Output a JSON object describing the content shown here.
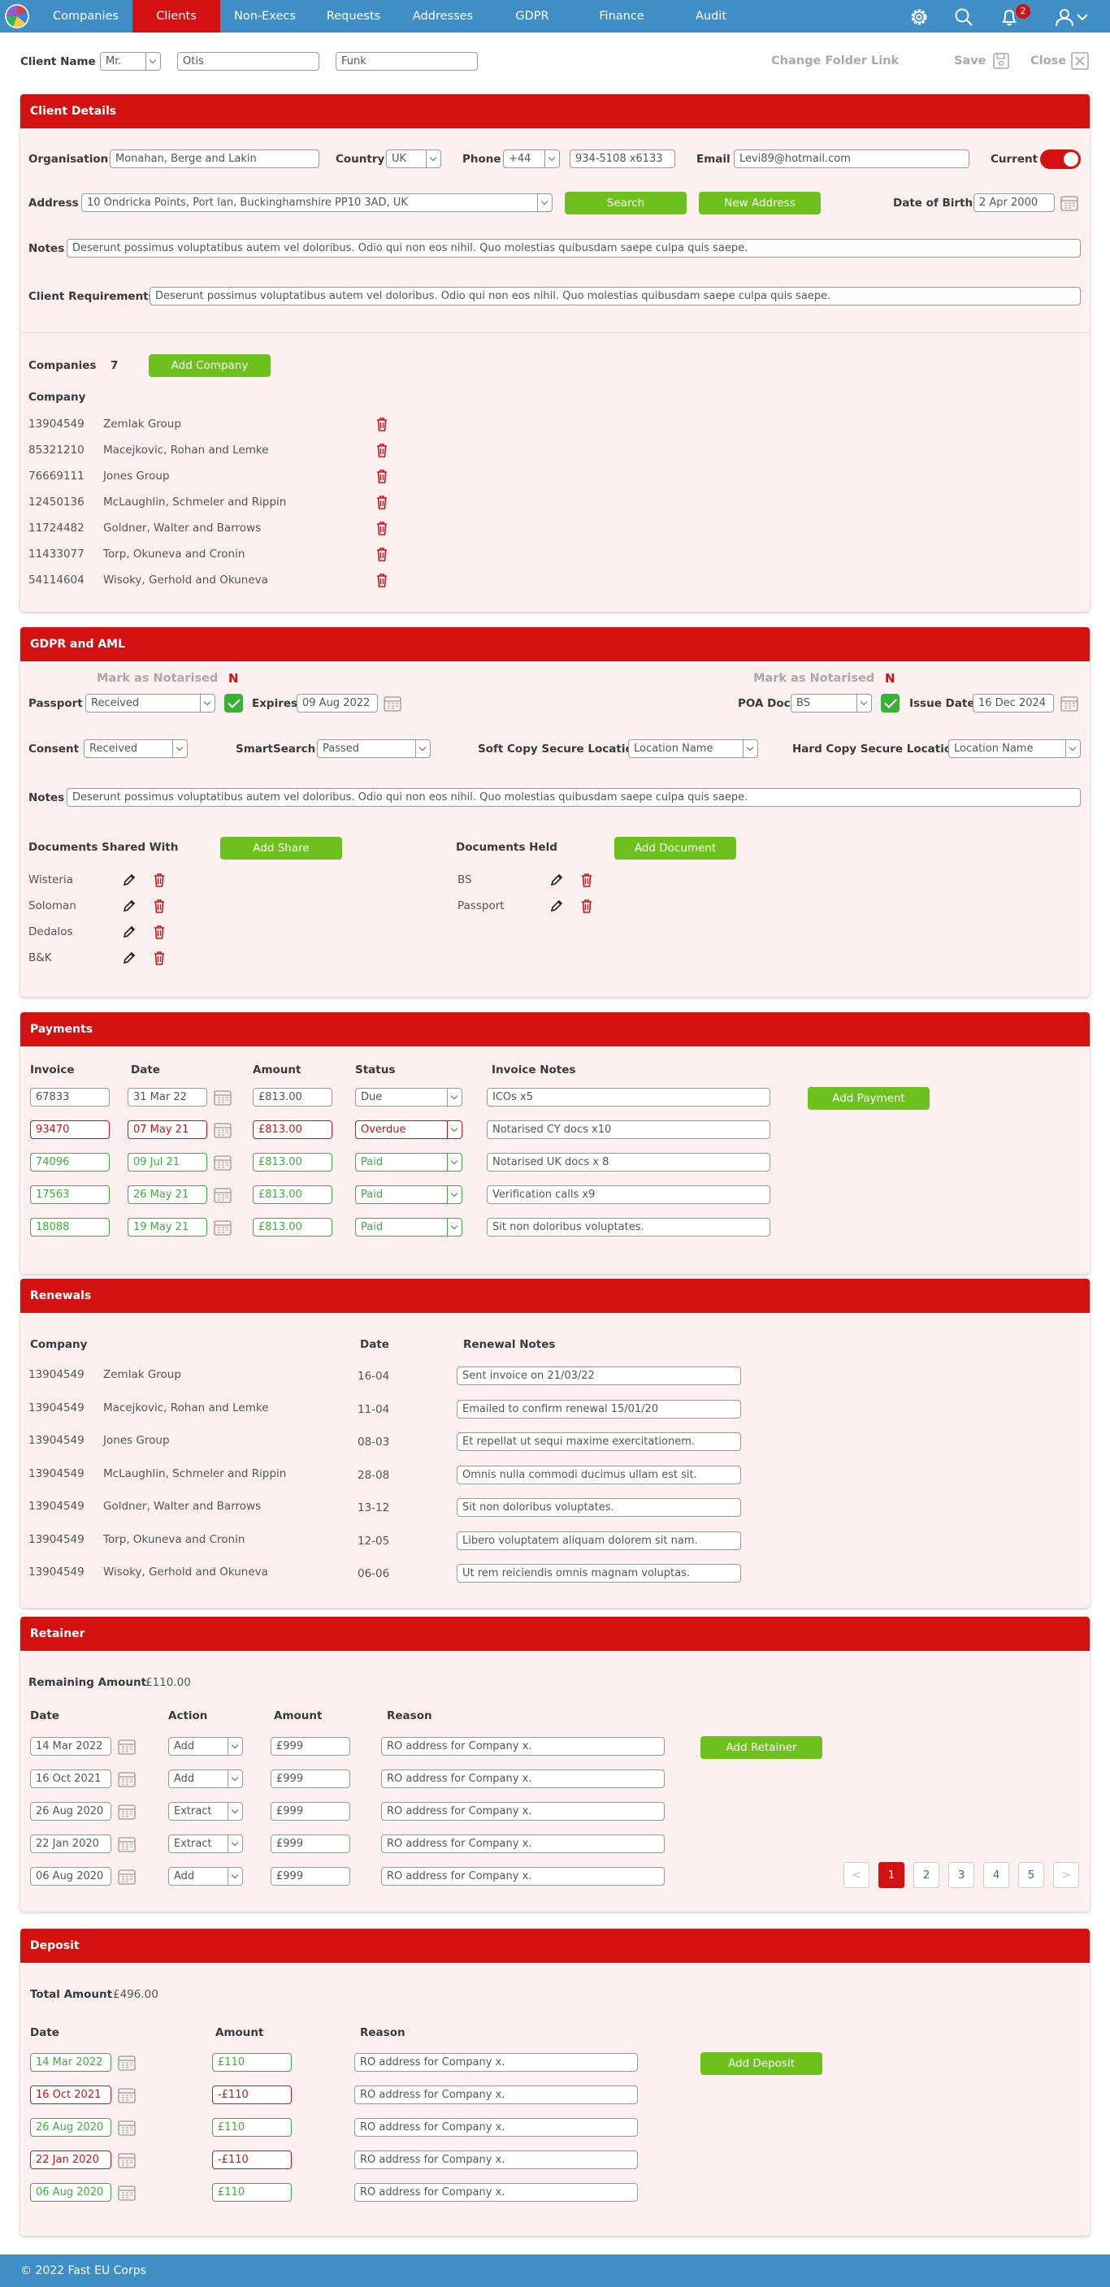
{
  "nav": {
    "items": [
      "Companies",
      "Clients",
      "Non-Execs",
      "Requests",
      "Addresses",
      "GDPR",
      "Finance",
      "Audit"
    ],
    "notification_count": "2"
  },
  "topbar": {
    "client_name_label": "Client Name",
    "title": "Mr.",
    "first_name": "Otis",
    "last_name": "Funk",
    "change_folder": "Change Folder Link",
    "save": "Save",
    "close": "Close"
  },
  "client_details": {
    "header": "Client Details",
    "organisation_label": "Organisation",
    "organisation": "Monahan, Berge and Lakin",
    "country_label": "Country",
    "country": "UK",
    "phone_label": "Phone",
    "phone_code": "+44",
    "phone": "934-5108 x6133",
    "email_label": "Email",
    "email": "Levi89@hotmail.com",
    "current_label": "Current",
    "address_label": "Address",
    "address": "10 Ondricka Points, Port Ian, Buckinghamshire PP10 3AD, UK",
    "search": "Search",
    "new_address": "New Address",
    "dob_label": "Date of Birth",
    "dob": "2 Apr 2000",
    "notes_label": "Notes",
    "notes": "Deserunt possimus voluptatibus autem vel doloribus. Odio qui non eos nihil. Quo molestias quibusdam saepe culpa quis saepe.",
    "req_label": "Client Requirements",
    "requirements": "Deserunt possimus voluptatibus autem vel doloribus. Odio qui non eos nihil. Quo molestias quibusdam saepe culpa quis saepe."
  },
  "companies": {
    "label": "Companies",
    "count": "7",
    "add": "Add Company",
    "column": "Company",
    "rows": [
      [
        "13904549",
        "Zemlak Group"
      ],
      [
        "85321210",
        "Macejkovic, Rohan and Lemke"
      ],
      [
        "76669111",
        "Jones Group"
      ],
      [
        "12450136",
        "McLaughlin, Schmeler and Rippin"
      ],
      [
        "11724482",
        "Goldner, Walter and Barrows"
      ],
      [
        "11433077",
        "Torp, Okuneva and Cronin"
      ],
      [
        "54114604",
        "Wisoky, Gerhold and Okuneva"
      ]
    ]
  },
  "gdpr": {
    "header": "GDPR and AML",
    "mark1": "Mark as Notarised",
    "n1": "N",
    "passport_label": "Passport",
    "passport": "Received",
    "expires_label": "Expires",
    "expires": "09 Aug 2022",
    "mark2": "Mark as Notarised",
    "n2": "N",
    "poa_label": "POA Doc",
    "poa": "BS",
    "issue_label": "Issue Date",
    "issue": "16 Dec 2024",
    "consent_label": "Consent",
    "consent": "Received",
    "smart_label": "SmartSearch",
    "smart": "Passed",
    "soft_label": "Soft Copy Secure Location",
    "soft": "Location Name",
    "hard_label": "Hard Copy Secure Location",
    "hard": "Location Name",
    "notes_label": "Notes",
    "notes": "Deserunt possimus voluptatibus autem vel doloribus. Odio qui non eos nihil. Quo molestias quibusdam saepe culpa quis saepe.",
    "shared_label": "Documents Shared With",
    "add_share": "Add Share",
    "shared": [
      "Wisteria",
      "Soloman",
      "Dedalos",
      "B&K"
    ],
    "held_label": "Documents Held",
    "add_doc": "Add Document",
    "held": [
      "BS",
      "Passport"
    ]
  },
  "payments": {
    "header": "Payments",
    "cols": [
      "Invoice",
      "Date",
      "Amount",
      "Status",
      "Invoice Notes"
    ],
    "add": "Add Payment",
    "rows": [
      {
        "invoice": "67833",
        "date": "31 Mar 22",
        "amount": "£813.00",
        "status": "Due",
        "notes": "ICOs x5",
        "tone": ""
      },
      {
        "invoice": "93470",
        "date": "07 May 21",
        "amount": "£813.00",
        "status": "Overdue",
        "notes": "Notarised CY docs x10",
        "tone": "r"
      },
      {
        "invoice": "74096",
        "date": "09 Jul 21",
        "amount": "£813.00",
        "status": "Paid",
        "notes": "Notarised UK docs x 8",
        "tone": "g"
      },
      {
        "invoice": "17563",
        "date": "26 May 21",
        "amount": "£813.00",
        "status": "Paid",
        "notes": "Verification calls x9",
        "tone": "g"
      },
      {
        "invoice": "18088",
        "date": "19 May 21",
        "amount": "£813.00",
        "status": "Paid",
        "notes": "Sit non doloribus voluptates.",
        "tone": "g"
      }
    ]
  },
  "renewals": {
    "header": "Renewals",
    "cols": [
      "Company",
      "Date",
      "Renewal Notes"
    ],
    "rows": [
      [
        "13904549",
        "Zemlak Group",
        "16-04",
        "Sent invoice on 21/03/22"
      ],
      [
        "13904549",
        "Macejkovic, Rohan and Lemke",
        "11-04",
        "Emailed to confirm renewal 15/01/20"
      ],
      [
        "13904549",
        "Jones Group",
        "08-03",
        "Et repellat ut sequi maxime exercitationem."
      ],
      [
        "13904549",
        "McLaughlin, Schmeler and Rippin",
        "28-08",
        "Omnis nulla commodi ducimus ullam est sit."
      ],
      [
        "13904549",
        "Goldner, Walter and Barrows",
        "13-12",
        "Sit non doloribus voluptates."
      ],
      [
        "13904549",
        "Torp, Okuneva and Cronin",
        "12-05",
        "Libero voluptatem aliquam dolorem sit nam."
      ],
      [
        "13904549",
        "Wisoky, Gerhold and Okuneva",
        "06-06",
        "Ut rem reiciendis omnis magnam voluptas."
      ]
    ]
  },
  "retainer": {
    "header": "Retainer",
    "remaining_label": "Remaining Amount",
    "remaining": "£110.00",
    "cols": [
      "Date",
      "Action",
      "Amount",
      "Reason"
    ],
    "add": "Add Retainer",
    "rows": [
      [
        "14 Mar 2022",
        "Add",
        "£999",
        "RO address for Company x."
      ],
      [
        "16 Oct 2021",
        "Add",
        "£999",
        "RO address for Company x."
      ],
      [
        "26 Aug 2020",
        "Extract",
        "£999",
        "RO address for Company x."
      ],
      [
        "22 Jan 2020",
        "Extract",
        "£999",
        "RO address for Company x."
      ],
      [
        "06 Aug 2020",
        "Add",
        "£999",
        "RO address for Company x."
      ]
    ],
    "pages": [
      "1",
      "2",
      "3",
      "4",
      "5"
    ],
    "prev": "<",
    "next": ">"
  },
  "deposit": {
    "header": "Deposit",
    "total_label": "Total Amount",
    "total": "£496.00",
    "cols": [
      "Date",
      "Amount",
      "Reason"
    ],
    "add": "Add Deposit",
    "rows": [
      {
        "date": "14 Mar 2022",
        "amount": "£110",
        "reason": "RO address for Company x.",
        "tone": "g"
      },
      {
        "date": "16 Oct 2021",
        "amount": "-£110",
        "reason": "RO address for Company x.",
        "tone": "r"
      },
      {
        "date": "26 Aug 2020",
        "amount": "£110",
        "reason": "RO address for Company x.",
        "tone": "g"
      },
      {
        "date": "22 Jan 2020",
        "amount": "-£110",
        "reason": "RO address for Company x.",
        "tone": "r"
      },
      {
        "date": "06 Aug 2020",
        "amount": "£110",
        "reason": "RO address for Company x.",
        "tone": "g"
      }
    ]
  },
  "footer": "© 2022 Fast EU Corps"
}
